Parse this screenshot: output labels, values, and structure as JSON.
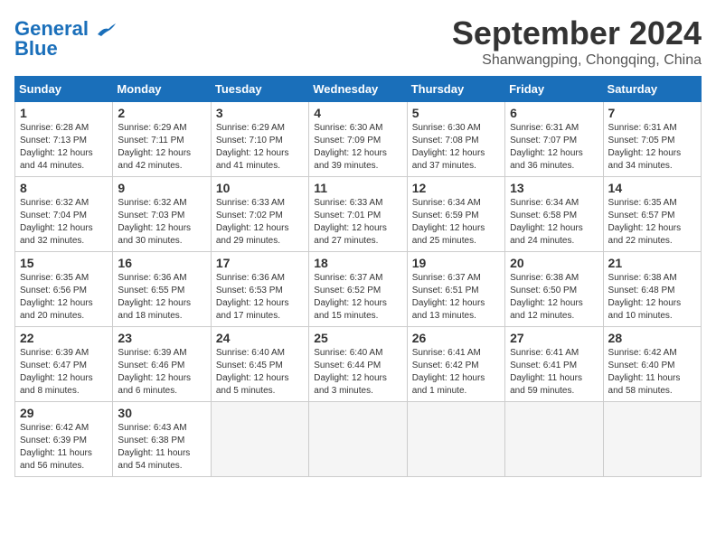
{
  "header": {
    "logo_line1": "General",
    "logo_line2": "Blue",
    "month": "September 2024",
    "location": "Shanwangping, Chongqing, China"
  },
  "days_of_week": [
    "Sunday",
    "Monday",
    "Tuesday",
    "Wednesday",
    "Thursday",
    "Friday",
    "Saturday"
  ],
  "weeks": [
    [
      {
        "day": "1",
        "info": "Sunrise: 6:28 AM\nSunset: 7:13 PM\nDaylight: 12 hours\nand 44 minutes."
      },
      {
        "day": "2",
        "info": "Sunrise: 6:29 AM\nSunset: 7:11 PM\nDaylight: 12 hours\nand 42 minutes."
      },
      {
        "day": "3",
        "info": "Sunrise: 6:29 AM\nSunset: 7:10 PM\nDaylight: 12 hours\nand 41 minutes."
      },
      {
        "day": "4",
        "info": "Sunrise: 6:30 AM\nSunset: 7:09 PM\nDaylight: 12 hours\nand 39 minutes."
      },
      {
        "day": "5",
        "info": "Sunrise: 6:30 AM\nSunset: 7:08 PM\nDaylight: 12 hours\nand 37 minutes."
      },
      {
        "day": "6",
        "info": "Sunrise: 6:31 AM\nSunset: 7:07 PM\nDaylight: 12 hours\nand 36 minutes."
      },
      {
        "day": "7",
        "info": "Sunrise: 6:31 AM\nSunset: 7:05 PM\nDaylight: 12 hours\nand 34 minutes."
      }
    ],
    [
      {
        "day": "8",
        "info": "Sunrise: 6:32 AM\nSunset: 7:04 PM\nDaylight: 12 hours\nand 32 minutes."
      },
      {
        "day": "9",
        "info": "Sunrise: 6:32 AM\nSunset: 7:03 PM\nDaylight: 12 hours\nand 30 minutes."
      },
      {
        "day": "10",
        "info": "Sunrise: 6:33 AM\nSunset: 7:02 PM\nDaylight: 12 hours\nand 29 minutes."
      },
      {
        "day": "11",
        "info": "Sunrise: 6:33 AM\nSunset: 7:01 PM\nDaylight: 12 hours\nand 27 minutes."
      },
      {
        "day": "12",
        "info": "Sunrise: 6:34 AM\nSunset: 6:59 PM\nDaylight: 12 hours\nand 25 minutes."
      },
      {
        "day": "13",
        "info": "Sunrise: 6:34 AM\nSunset: 6:58 PM\nDaylight: 12 hours\nand 24 minutes."
      },
      {
        "day": "14",
        "info": "Sunrise: 6:35 AM\nSunset: 6:57 PM\nDaylight: 12 hours\nand 22 minutes."
      }
    ],
    [
      {
        "day": "15",
        "info": "Sunrise: 6:35 AM\nSunset: 6:56 PM\nDaylight: 12 hours\nand 20 minutes."
      },
      {
        "day": "16",
        "info": "Sunrise: 6:36 AM\nSunset: 6:55 PM\nDaylight: 12 hours\nand 18 minutes."
      },
      {
        "day": "17",
        "info": "Sunrise: 6:36 AM\nSunset: 6:53 PM\nDaylight: 12 hours\nand 17 minutes."
      },
      {
        "day": "18",
        "info": "Sunrise: 6:37 AM\nSunset: 6:52 PM\nDaylight: 12 hours\nand 15 minutes."
      },
      {
        "day": "19",
        "info": "Sunrise: 6:37 AM\nSunset: 6:51 PM\nDaylight: 12 hours\nand 13 minutes."
      },
      {
        "day": "20",
        "info": "Sunrise: 6:38 AM\nSunset: 6:50 PM\nDaylight: 12 hours\nand 12 minutes."
      },
      {
        "day": "21",
        "info": "Sunrise: 6:38 AM\nSunset: 6:48 PM\nDaylight: 12 hours\nand 10 minutes."
      }
    ],
    [
      {
        "day": "22",
        "info": "Sunrise: 6:39 AM\nSunset: 6:47 PM\nDaylight: 12 hours\nand 8 minutes."
      },
      {
        "day": "23",
        "info": "Sunrise: 6:39 AM\nSunset: 6:46 PM\nDaylight: 12 hours\nand 6 minutes."
      },
      {
        "day": "24",
        "info": "Sunrise: 6:40 AM\nSunset: 6:45 PM\nDaylight: 12 hours\nand 5 minutes."
      },
      {
        "day": "25",
        "info": "Sunrise: 6:40 AM\nSunset: 6:44 PM\nDaylight: 12 hours\nand 3 minutes."
      },
      {
        "day": "26",
        "info": "Sunrise: 6:41 AM\nSunset: 6:42 PM\nDaylight: 12 hours\nand 1 minute."
      },
      {
        "day": "27",
        "info": "Sunrise: 6:41 AM\nSunset: 6:41 PM\nDaylight: 11 hours\nand 59 minutes."
      },
      {
        "day": "28",
        "info": "Sunrise: 6:42 AM\nSunset: 6:40 PM\nDaylight: 11 hours\nand 58 minutes."
      }
    ],
    [
      {
        "day": "29",
        "info": "Sunrise: 6:42 AM\nSunset: 6:39 PM\nDaylight: 11 hours\nand 56 minutes."
      },
      {
        "day": "30",
        "info": "Sunrise: 6:43 AM\nSunset: 6:38 PM\nDaylight: 11 hours\nand 54 minutes."
      },
      {
        "day": "",
        "info": ""
      },
      {
        "day": "",
        "info": ""
      },
      {
        "day": "",
        "info": ""
      },
      {
        "day": "",
        "info": ""
      },
      {
        "day": "",
        "info": ""
      }
    ]
  ]
}
